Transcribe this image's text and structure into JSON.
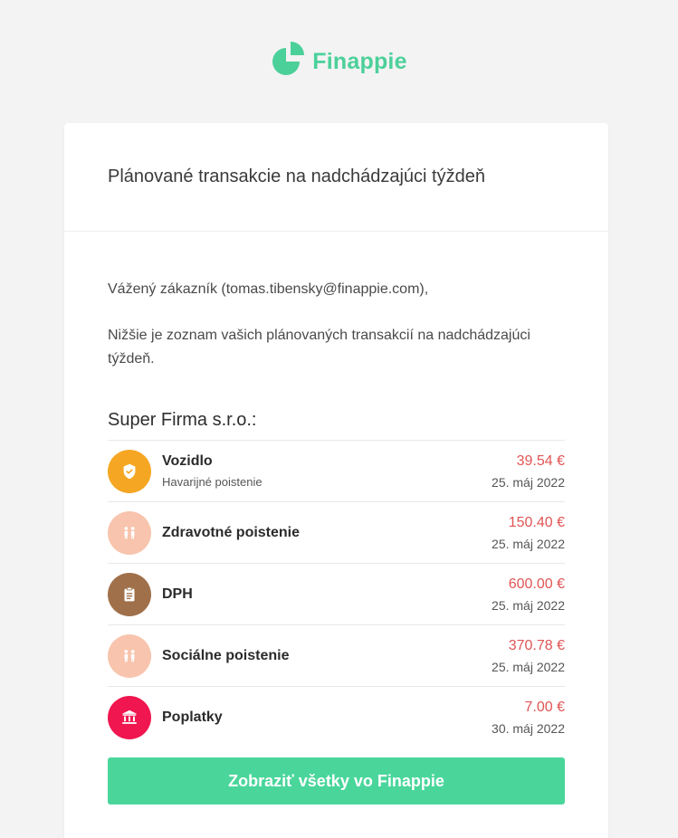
{
  "logo": {
    "text": "Finappie",
    "color": "#4cd09a",
    "icon": "pie-chart-logo-icon"
  },
  "card": {
    "title": "Plánované transakcie na nadchádzajúci týždeň"
  },
  "message": {
    "greeting": "Vážený zákazník (tomas.tibensky@finappie.com),",
    "intro": "Nižšie je zoznam vašich plánovaných transakcií na nadchádzajúci týždeň."
  },
  "company": {
    "name": "Super Firma s.r.o.:"
  },
  "transactions": [
    {
      "name": "Vozidlo",
      "subtitle": "Havarijné poistenie",
      "amount": "39.54 €",
      "date": "25. máj 2022",
      "icon": "shield-icon",
      "color": "#f5a623"
    },
    {
      "name": "Zdravotné poistenie",
      "subtitle": "",
      "amount": "150.40 €",
      "date": "25. máj 2022",
      "icon": "people-icon",
      "color": "#f8c4ad"
    },
    {
      "name": "DPH",
      "subtitle": "",
      "amount": "600.00 €",
      "date": "25. máj 2022",
      "icon": "clipboard-icon",
      "color": "#a0704a"
    },
    {
      "name": "Sociálne poistenie",
      "subtitle": "",
      "amount": "370.78 €",
      "date": "25. máj 2022",
      "icon": "people-icon",
      "color": "#f8c4ad"
    },
    {
      "name": "Poplatky",
      "subtitle": "",
      "amount": "7.00 €",
      "date": "30. máj 2022",
      "icon": "bank-icon",
      "color": "#f0164f"
    }
  ],
  "cta": {
    "label": "Zobraziť všetky vo Finappie",
    "color": "#4ad69b"
  },
  "colors": {
    "amount": "#e05555",
    "background": "#f3f3f3"
  }
}
